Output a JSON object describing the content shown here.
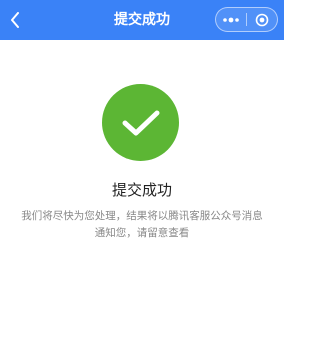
{
  "header": {
    "title": "提交成功",
    "icons": {
      "back": "chevron-left-icon",
      "more": "more-dots-icon",
      "close": "target-circle-icon"
    },
    "color": "#3a82f7"
  },
  "result": {
    "icon": "checkmark-icon",
    "icon_color": "#5cb634",
    "title": "提交成功",
    "desc_line1": "我们将尽快为您处理，结果将以腾讯客服公众号消息",
    "desc_line2": "通知您，请留意查看"
  }
}
